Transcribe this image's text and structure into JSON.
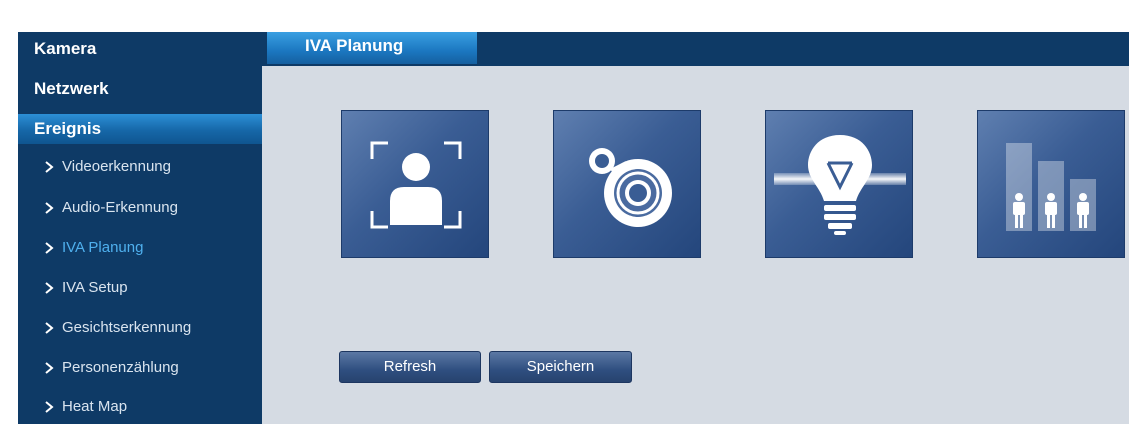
{
  "sidebar": {
    "sections": [
      {
        "label": "Kamera"
      },
      {
        "label": "Netzwerk"
      },
      {
        "label": "Ereignis",
        "active": true
      }
    ],
    "items": [
      {
        "label": "Videoerkennung"
      },
      {
        "label": "Audio-Erkennung"
      },
      {
        "label": "IVA Planung",
        "active": true
      },
      {
        "label": "IVA Setup"
      },
      {
        "label": "Gesichtserkennung"
      },
      {
        "label": "Personenzählung"
      },
      {
        "label": "Heat Map"
      }
    ]
  },
  "header": {
    "tab_label": "IVA Planung"
  },
  "tiles": [
    {
      "icon": "face-detection-icon"
    },
    {
      "icon": "audio-target-icon"
    },
    {
      "icon": "lightbulb-icon"
    },
    {
      "icon": "people-counting-icon"
    }
  ],
  "buttons": {
    "refresh": "Refresh",
    "save": "Speichern"
  },
  "colors": {
    "nav_bg": "#0e3a66",
    "active_blue": "#1b77c0",
    "active_text": "#4fb0ee",
    "content_bg": "#d5dbe3",
    "tile_bg": "#3a5d94"
  }
}
